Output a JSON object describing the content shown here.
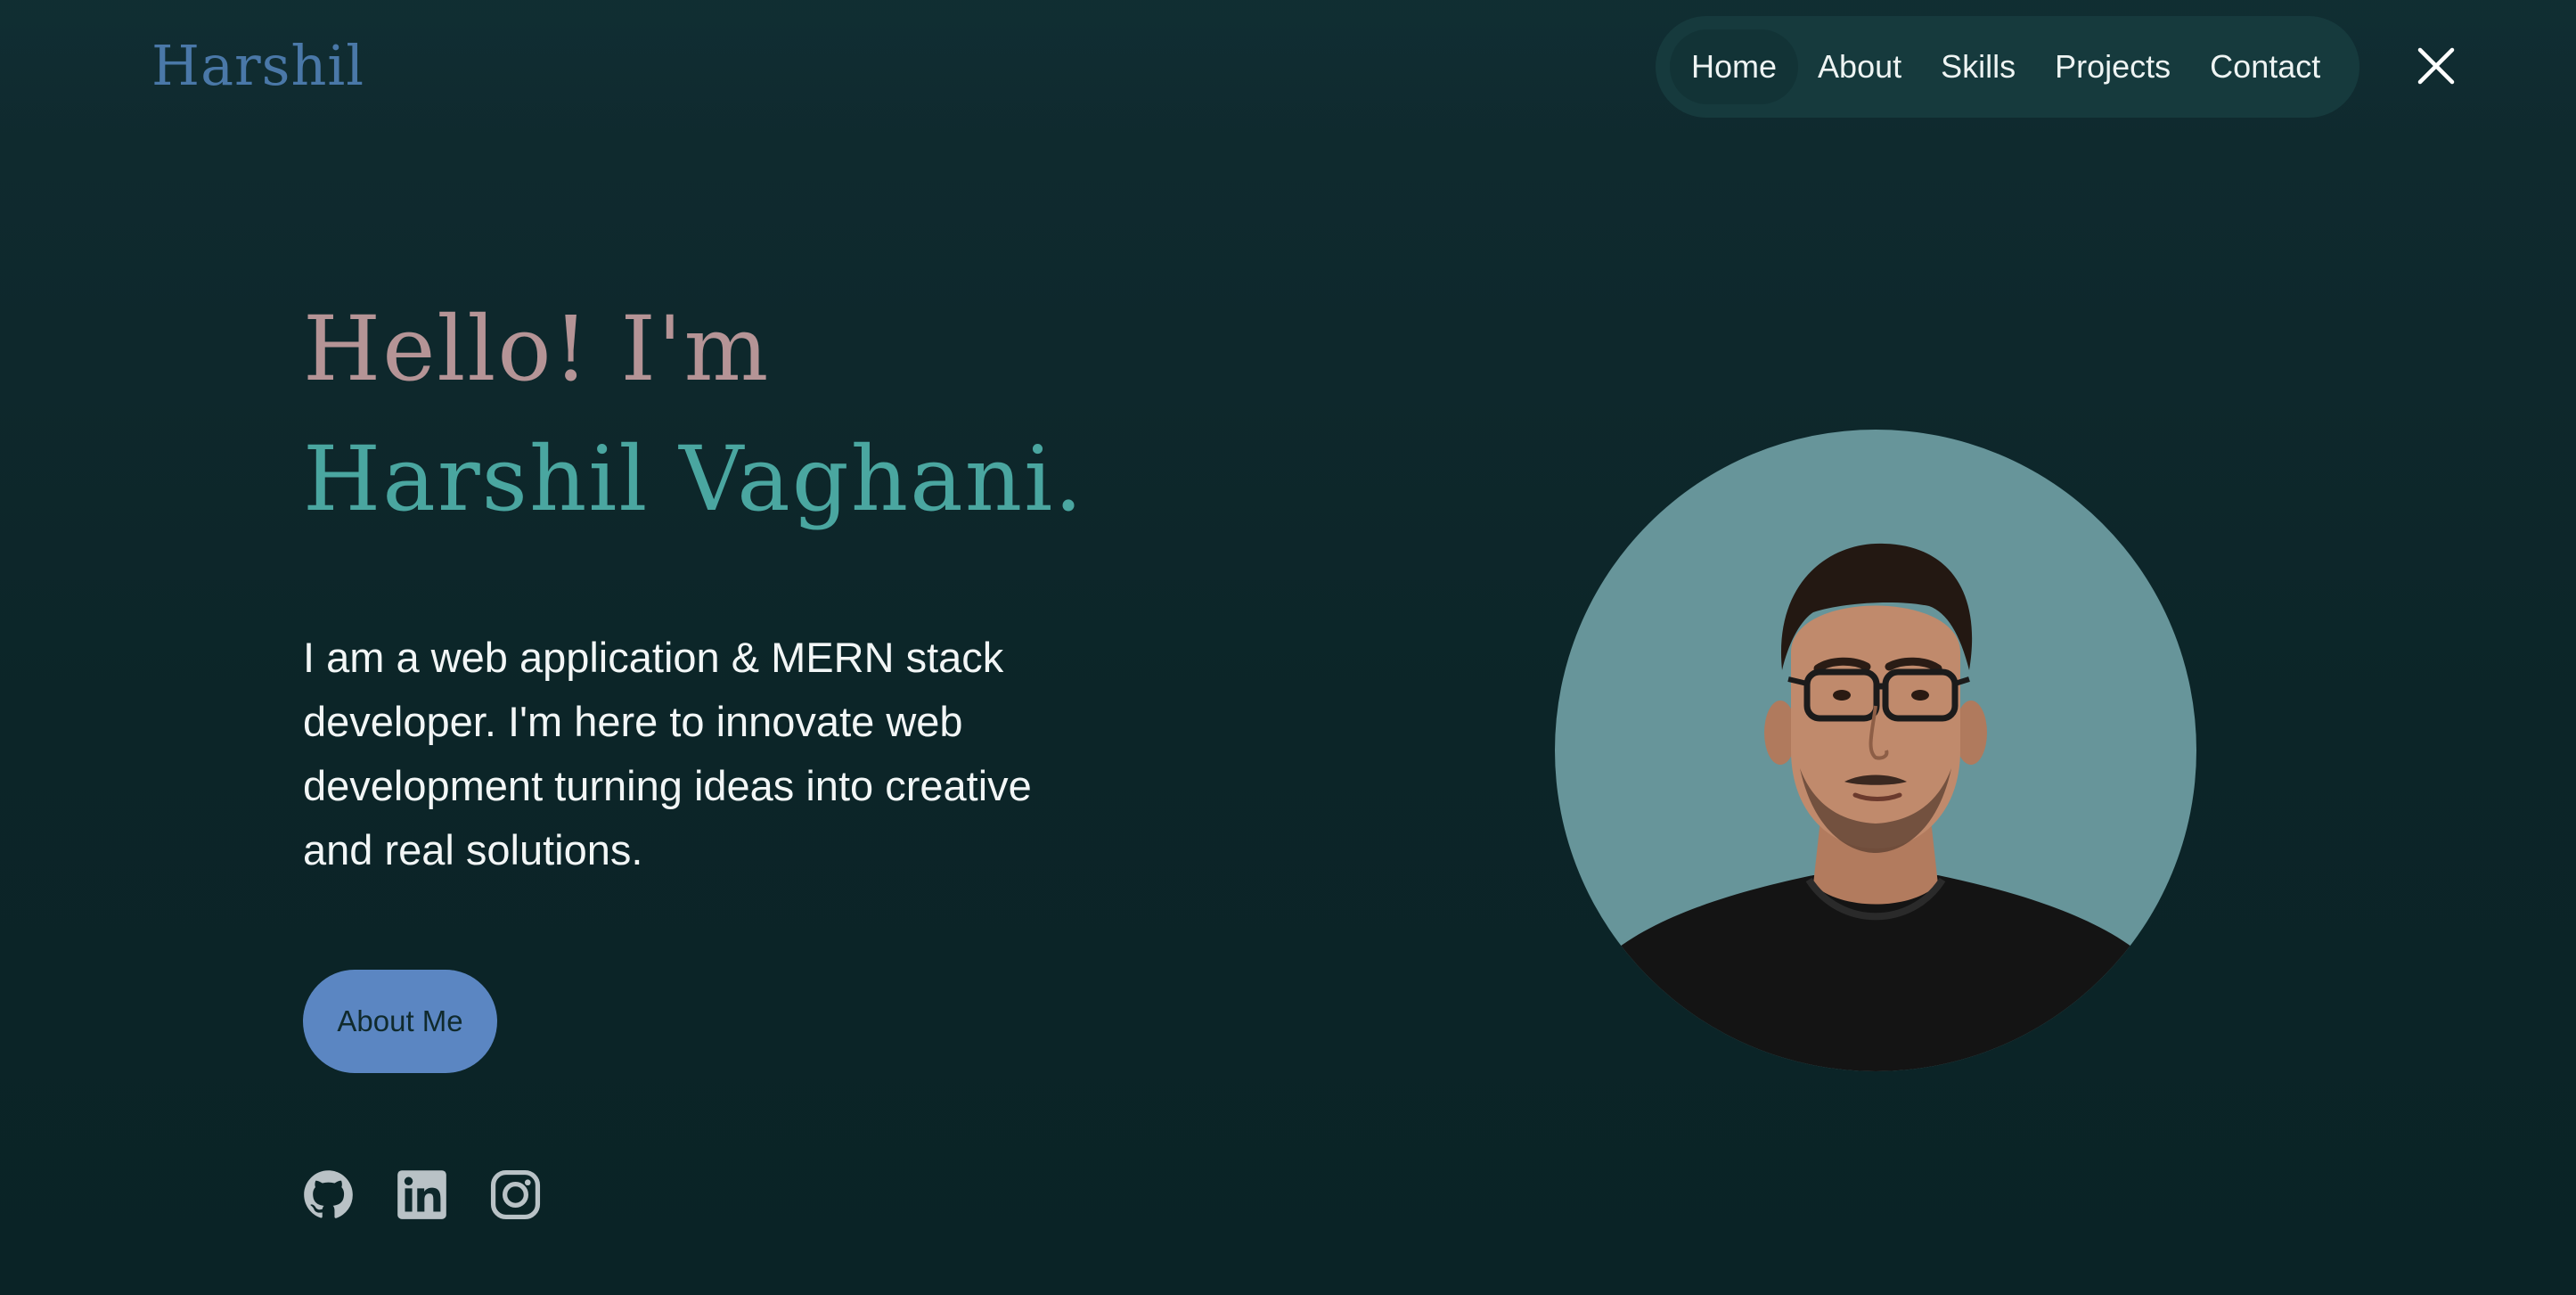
{
  "header": {
    "brand": "Harshil",
    "nav": [
      {
        "label": "Home",
        "active": true
      },
      {
        "label": "About",
        "active": false
      },
      {
        "label": "Skills",
        "active": false
      },
      {
        "label": "Projects",
        "active": false
      },
      {
        "label": "Contact",
        "active": false
      }
    ],
    "close_icon": "close-icon"
  },
  "hero": {
    "greeting": "Hello! I'm",
    "name": "Harshil Vaghani.",
    "intro": "I am a web application & MERN stack developer. I'm here to innovate web development turning ideas into creative and real solutions.",
    "cta_label": "About Me",
    "socials": [
      {
        "icon": "github-icon"
      },
      {
        "icon": "linkedin-icon"
      },
      {
        "icon": "instagram-icon"
      }
    ],
    "portrait": "profile-photo"
  },
  "colors": {
    "background": "#0e282b",
    "brand": "#4a78a8",
    "greeting": "#b59496",
    "name": "#4aa6a0",
    "button": "#5b86c2",
    "nav_bg": "#163a3d",
    "portrait_bg": "#67959a",
    "icon": "#b9c2c6"
  }
}
